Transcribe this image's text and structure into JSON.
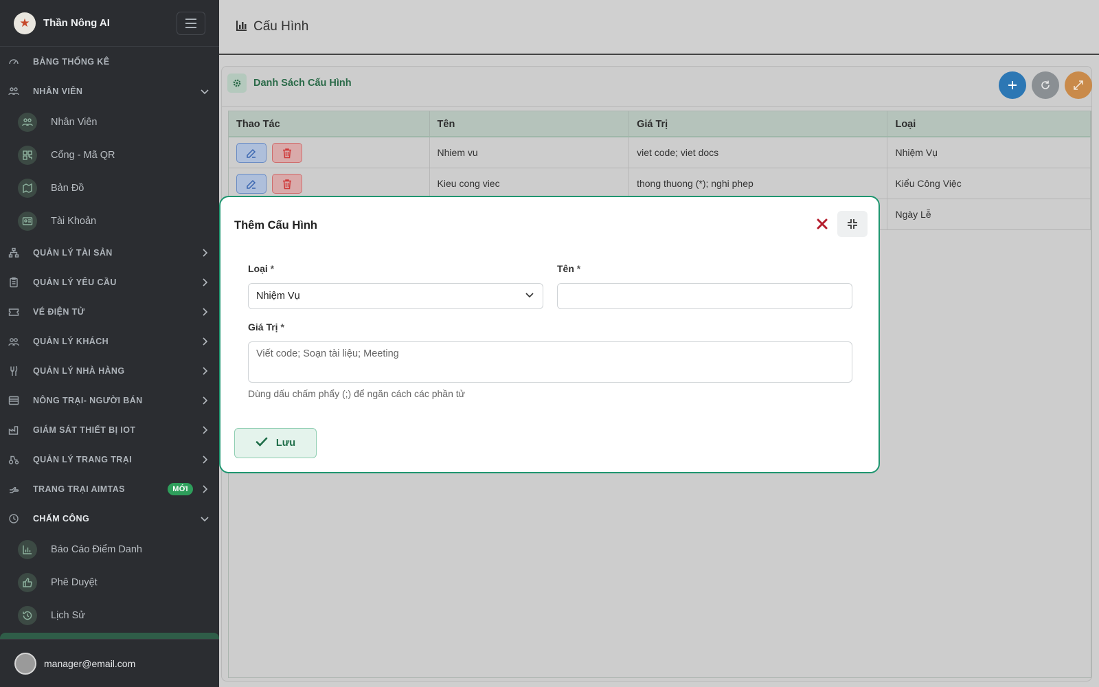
{
  "brand": {
    "name": "Thần Nông AI"
  },
  "sidebar": {
    "items": [
      {
        "type": "section",
        "label": "BẢNG THỐNG KÊ",
        "icon": "dashboard-icon",
        "arrow": "none"
      },
      {
        "type": "section",
        "label": "NHÂN VIÊN",
        "icon": "people-icon",
        "arrow": "down"
      },
      {
        "type": "sub",
        "label": "Nhân Viên",
        "icon": "people-icon"
      },
      {
        "type": "sub",
        "label": "Cổng - Mã QR",
        "icon": "qr-icon"
      },
      {
        "type": "sub",
        "label": "Bản Đồ",
        "icon": "map-icon"
      },
      {
        "type": "sub",
        "label": "Tài Khoản",
        "icon": "id-card-icon"
      },
      {
        "type": "section",
        "label": "QUẢN LÝ TÀI SẢN",
        "icon": "hierarchy-icon",
        "arrow": "right"
      },
      {
        "type": "section",
        "label": "QUẢN LÝ YÊU CẦU",
        "icon": "clipboard-icon",
        "arrow": "right"
      },
      {
        "type": "section",
        "label": "VÉ ĐIỆN TỬ",
        "icon": "ticket-icon",
        "arrow": "right"
      },
      {
        "type": "section",
        "label": "QUẢN LÝ KHÁCH",
        "icon": "guests-icon",
        "arrow": "right"
      },
      {
        "type": "section",
        "label": "QUẢN LÝ NHÀ HÀNG",
        "icon": "utensils-icon",
        "arrow": "right"
      },
      {
        "type": "section",
        "label": "NÔNG TRẠI- NGƯỜI BÁN",
        "icon": "store-icon",
        "arrow": "right"
      },
      {
        "type": "section",
        "label": "GIÁM SÁT THIẾT BỊ IOT",
        "icon": "factory-icon",
        "arrow": "right"
      },
      {
        "type": "section",
        "label": "QUẢN LÝ TRANG TRẠI",
        "icon": "tractor-icon",
        "arrow": "right"
      },
      {
        "type": "section",
        "label": "TRANG TRẠI AIMTAS",
        "icon": "hand-icon",
        "arrow": "right",
        "badge": "MỚI"
      },
      {
        "type": "section",
        "label": "CHẤM CÔNG",
        "icon": "clock-icon",
        "arrow": "down",
        "active": true
      },
      {
        "type": "sub",
        "label": "Báo Cáo Điểm Danh",
        "icon": "bar-chart-icon"
      },
      {
        "type": "sub",
        "label": "Phê Duyệt",
        "icon": "thumbs-up-icon"
      },
      {
        "type": "sub",
        "label": "Lịch Sử",
        "icon": "history-icon"
      }
    ]
  },
  "user": {
    "email": "manager@email.com"
  },
  "header": {
    "title": "Cấu Hình"
  },
  "card": {
    "title": "Danh Sách Cấu Hình"
  },
  "table": {
    "columns": [
      "Thao Tác",
      "Tên",
      "Giá Trị",
      "Loại"
    ],
    "rows": [
      {
        "name": "Nhiem vu",
        "value": "viet code; viet docs",
        "type": "Nhiệm Vụ"
      },
      {
        "name": "Kieu cong viec",
        "value": "thong thuong (*); nghi phep",
        "type": "Kiểu Công Việc"
      },
      {
        "name": "",
        "value": "",
        "type": "Ngày Lễ"
      }
    ]
  },
  "modal": {
    "title": "Thêm Cấu Hình",
    "type_label": "Loại",
    "type_value": "Nhiệm Vụ",
    "name_label": "Tên",
    "name_value": "",
    "value_label": "Giá Trị",
    "value_placeholder": "Viết code; Soạn tài liệu; Meeting",
    "required_mark": "*",
    "hint": "Dùng dấu chấm phẩy (;) để ngăn cách các phần tử",
    "save_label": "Lưu"
  },
  "colors": {
    "accent": "#1f9670",
    "sidebar_bg": "#2b2d31",
    "add_button": "#2c77b4",
    "delete": "#cf3a3a",
    "edit": "#3a66b0"
  }
}
